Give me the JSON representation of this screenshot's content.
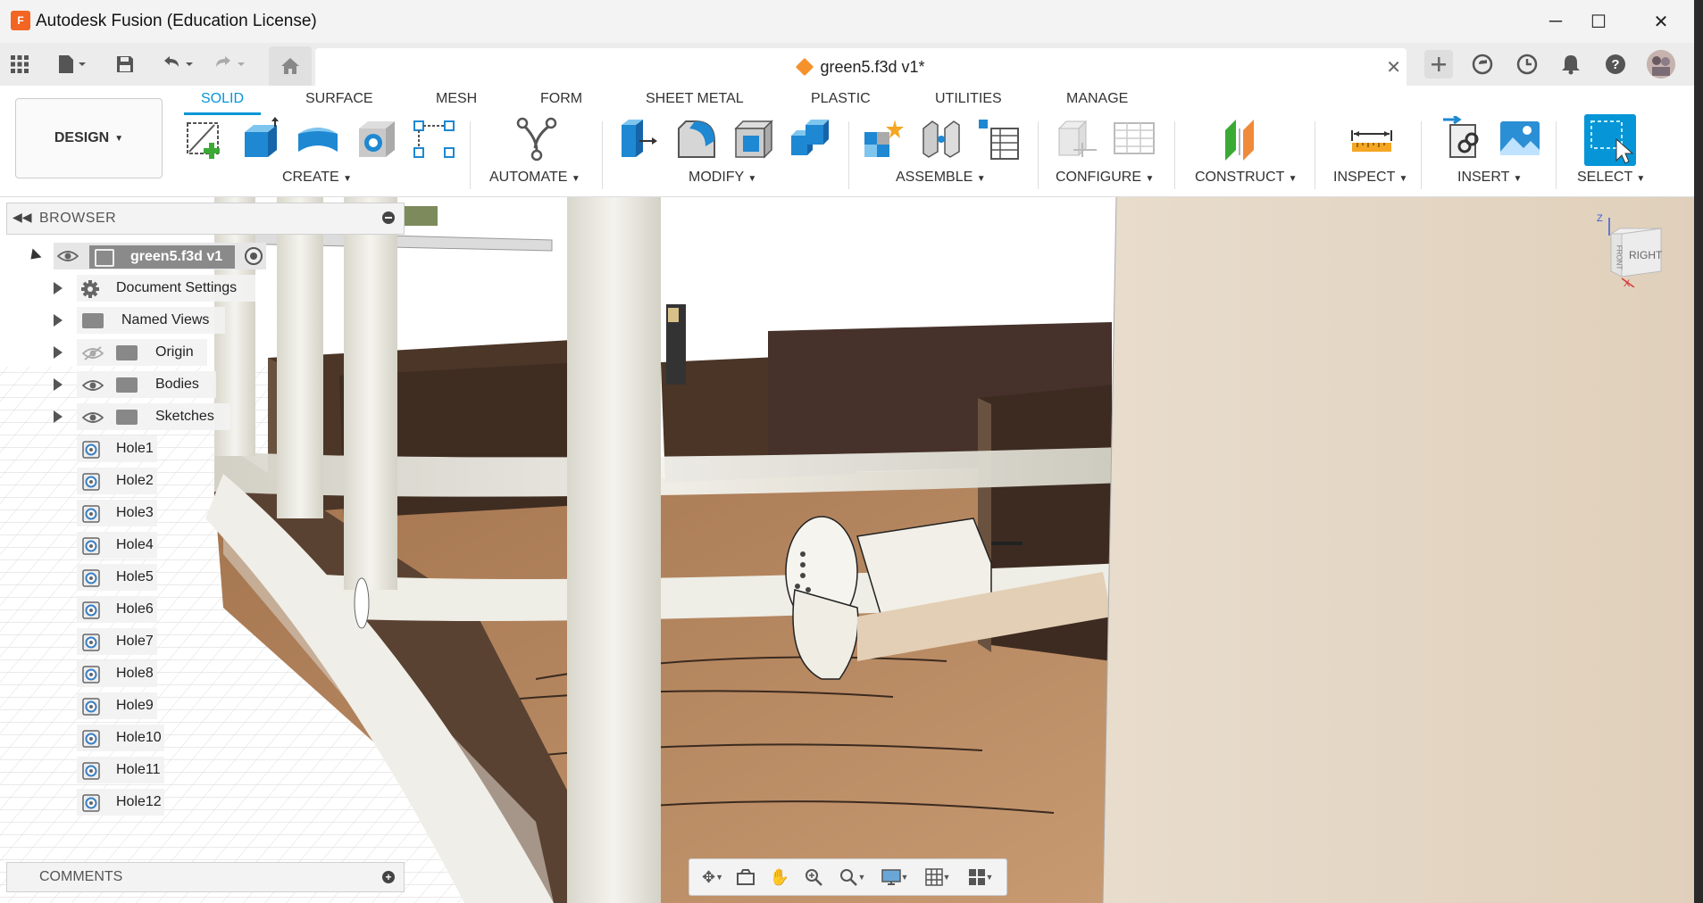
{
  "window": {
    "title": "Autodesk Fusion (Education License)",
    "logo_letter": "F",
    "minimize": "─",
    "maximize": "☐",
    "close": "✕"
  },
  "document_tab": {
    "title": "green5.f3d v1*",
    "close": "✕"
  },
  "workspace": {
    "label": "DESIGN"
  },
  "ribbon_tabs": [
    "SOLID",
    "SURFACE",
    "MESH",
    "FORM",
    "SHEET METAL",
    "PLASTIC",
    "UTILITIES",
    "MANAGE"
  ],
  "ribbon_groups": {
    "create": "CREATE",
    "automate": "AUTOMATE",
    "modify": "MODIFY",
    "assemble": "ASSEMBLE",
    "configure": "CONFIGURE",
    "construct": "CONSTRUCT",
    "inspect": "INSPECT",
    "insert": "INSERT",
    "select": "SELECT"
  },
  "browser": {
    "title": "BROWSER",
    "root": "green5.f3d v1",
    "folders": [
      {
        "label": "Document Settings",
        "icon": "gear-icon"
      },
      {
        "label": "Named Views",
        "icon": "folder-icon"
      },
      {
        "label": "Origin",
        "icon": "folder-icon",
        "visibility": "hidden"
      },
      {
        "label": "Bodies",
        "icon": "folder-icon",
        "visibility": "visible"
      },
      {
        "label": "Sketches",
        "icon": "folder-icon",
        "visibility": "visible"
      }
    ],
    "features": [
      "Hole1",
      "Hole2",
      "Hole3",
      "Hole4",
      "Hole5",
      "Hole6",
      "Hole7",
      "Hole8",
      "Hole9",
      "Hole10",
      "Hole11",
      "Hole12"
    ]
  },
  "comments": {
    "title": "COMMENTS"
  },
  "viewcube": {
    "face": "RIGHT",
    "side": "FRONT",
    "axis_z": "Z",
    "axis_x": "X"
  },
  "colors": {
    "accent": "#0696d7",
    "brand": "#f26522",
    "wood_dark": "#4b3628",
    "wood_light": "#b8845c",
    "beige_wall": "#e5d6c3",
    "pipe": "#ecebe3"
  }
}
